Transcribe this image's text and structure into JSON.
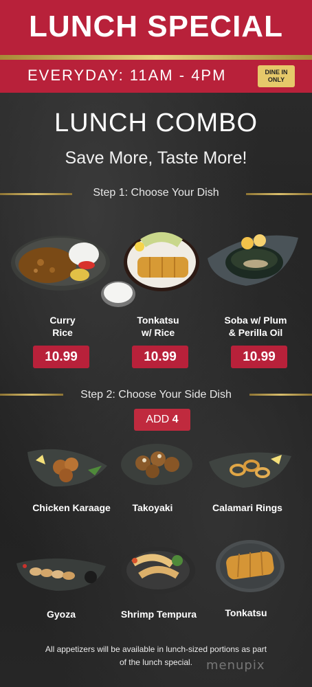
{
  "header": {
    "title": "LUNCH SPECIAL",
    "hours": "EVERYDAY: 11AM - 4PM",
    "badge_line1": "DINE IN",
    "badge_line2": "ONLY"
  },
  "combo": {
    "title": "LUNCH COMBO",
    "subtitle": "Save More, Taste More!"
  },
  "step1": {
    "label": "Step 1: Choose Your Dish",
    "dishes": [
      {
        "line1": "Curry",
        "line2": "Rice",
        "price": "10.99"
      },
      {
        "line1": "Tonkatsu",
        "line2": "w/ Rice",
        "price": "10.99"
      },
      {
        "line1": "Soba w/ Plum",
        "line2": "& Perilla Oil",
        "price": "10.99"
      }
    ]
  },
  "step2": {
    "label": "Step 2: Choose Your Side Dish",
    "add_prefix": "ADD",
    "add_amount": "4",
    "sides": [
      "Chicken Karaage",
      "Takoyaki",
      "Calamari  Rings",
      "Gyoza",
      "Shrimp Tempura",
      "Tonkatsu"
    ]
  },
  "footer": {
    "note_line1": "All appetizers will be available in lunch-sized portions as part",
    "note_line2": "of the lunch special."
  },
  "watermark": "menupix",
  "colors": {
    "brand_red": "#b8213a",
    "gold": "#e8cf7c",
    "badge_gold": "#e6c96a",
    "background": "#1e1e1e"
  }
}
